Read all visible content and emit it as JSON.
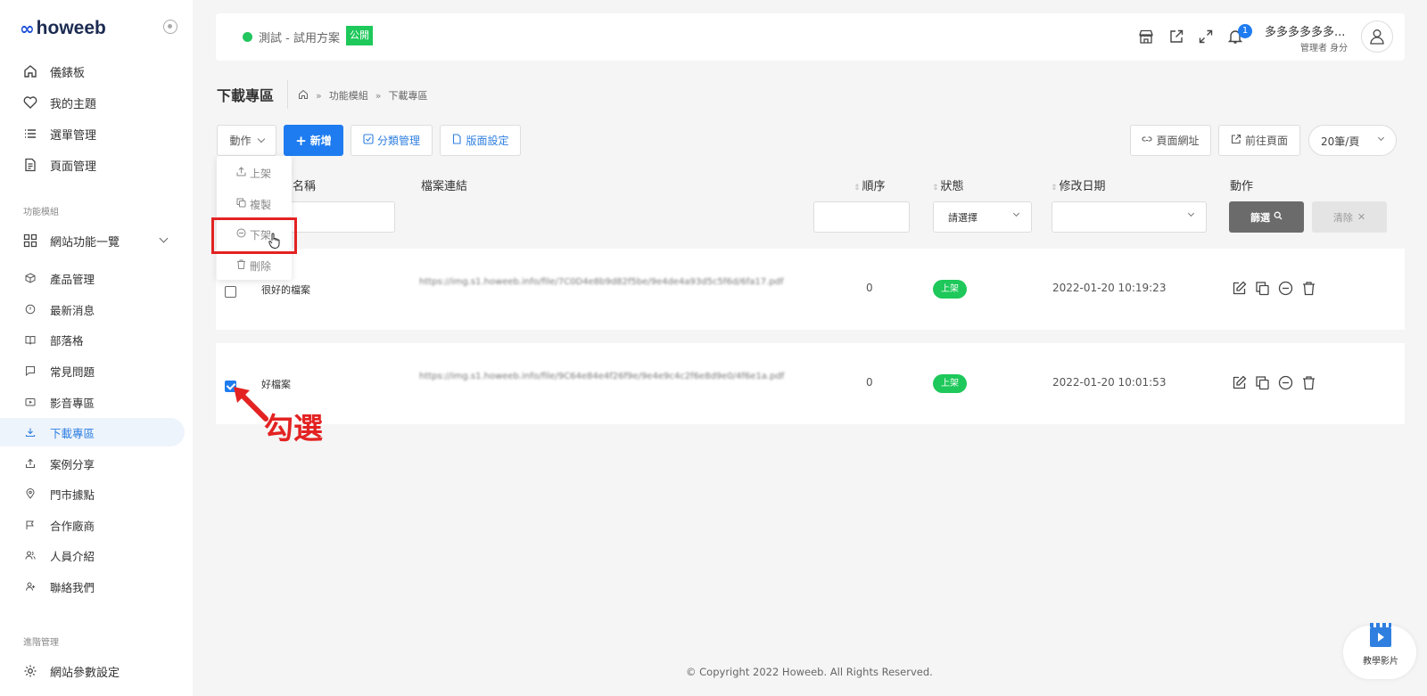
{
  "brand": {
    "logo_mark": "∞",
    "logo_text": "howeeb"
  },
  "sidebar": {
    "items": [
      {
        "label": "儀錶板",
        "icon": "home-icon"
      },
      {
        "label": "我的主題",
        "icon": "heart-icon"
      },
      {
        "label": "選單管理",
        "icon": "list-icon"
      },
      {
        "label": "頁面管理",
        "icon": "file-icon"
      }
    ],
    "section_modules": "功能模組",
    "module_group": {
      "label": "網站功能一覽",
      "icon": "grid-icon"
    },
    "modules": [
      {
        "label": "產品管理",
        "icon": "box-icon"
      },
      {
        "label": "最新消息",
        "icon": "clock-icon"
      },
      {
        "label": "部落格",
        "icon": "book-icon"
      },
      {
        "label": "常見問題",
        "icon": "chat-icon"
      },
      {
        "label": "影音專區",
        "icon": "video-icon"
      },
      {
        "label": "下載專區",
        "icon": "download-icon"
      },
      {
        "label": "案例分享",
        "icon": "share-icon"
      },
      {
        "label": "門市據點",
        "icon": "pin-icon"
      },
      {
        "label": "合作廠商",
        "icon": "flag-icon"
      },
      {
        "label": "人員介紹",
        "icon": "users-icon"
      },
      {
        "label": "聯絡我們",
        "icon": "contact-icon"
      }
    ],
    "section_advanced": "進階管理",
    "settings": {
      "label": "網站參數設定",
      "icon": "gear-icon"
    }
  },
  "header": {
    "site_name": "測試 - 試用方案",
    "public_badge": "公開",
    "notification_count": "1",
    "user_name": "多多多多多多...",
    "user_role": "管理者 身分"
  },
  "page": {
    "title": "下載專區",
    "breadcrumb": [
      "功能模組",
      "下載專區"
    ]
  },
  "toolbar": {
    "action": "動作",
    "add": "新增",
    "category": "分類管理",
    "layout": "版面設定",
    "page_url": "頁面網址",
    "goto_page": "前往頁面",
    "per_page": "20筆/頁"
  },
  "action_menu": [
    "上架",
    "複製",
    "下架",
    "刪除"
  ],
  "table": {
    "columns": [
      "名稱",
      "檔案連結",
      "順序",
      "狀態",
      "修改日期",
      "動作"
    ],
    "status_placeholder": "請選擇",
    "filter_btn": "篩選",
    "clear_btn": "清除",
    "rows": [
      {
        "checked": false,
        "name": "很好的檔案",
        "link": "https://img.s1.howeeb.info/file/7C0D4e8b9d82f5be/9e4de4a93d5c5f6d/6fa17.pdf",
        "order": "0",
        "status": "上架",
        "date": "2022-01-20 10:19:23"
      },
      {
        "checked": true,
        "name": "好檔案",
        "link": "https://img.s1.howeeb.info/file/9C64e84e4f26f9e/9e4e9c4c2f6e8d9e0/4f6e1a.pdf",
        "order": "0",
        "status": "上架",
        "date": "2022-01-20 10:01:53"
      }
    ]
  },
  "annotation": "勾選",
  "footer": "© Copyright 2022 Howeeb. All Rights Reserved.",
  "tutorial": "教學影片",
  "colors": {
    "primary": "#1e7cf0",
    "success": "#1ec85a",
    "annotation": "#e32222",
    "active_bg": "#eef4fc"
  }
}
